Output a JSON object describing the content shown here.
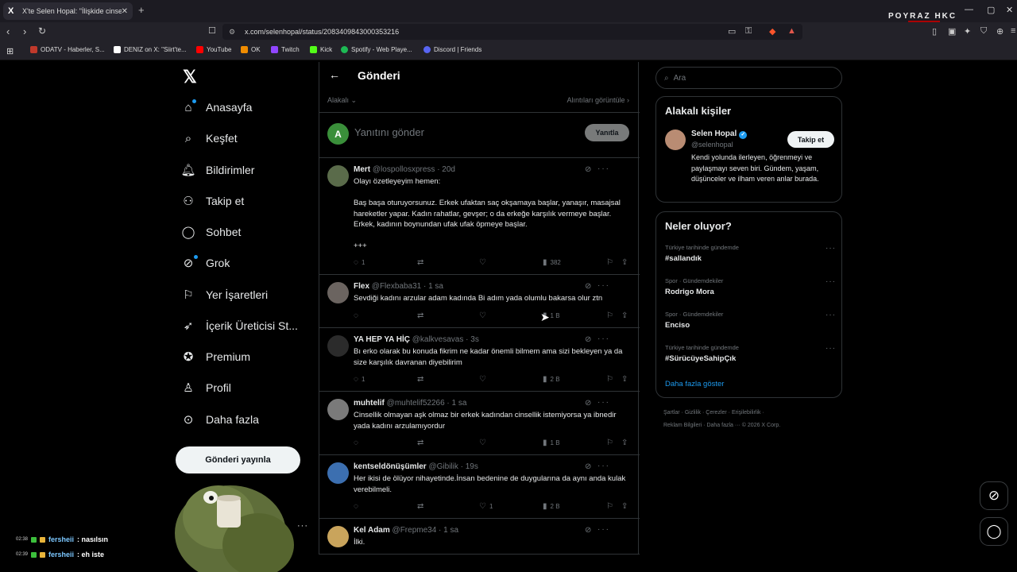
{
  "browser": {
    "tab_title": "X'te Selen Hopal: \"İlişkide cinsell",
    "tab_favicon": "X",
    "url": "x.com/selenhopal/status/2083409843000353216",
    "overlay_brand": "POYRAZ HKC",
    "bookmarks": [
      {
        "label": "ODATV - Haberler, S...",
        "color": "#c0392b"
      },
      {
        "label": "DENIZ on X: \"Siirt'te...",
        "color": "#ffffff"
      },
      {
        "label": "YouTube",
        "color": "#ff0000"
      },
      {
        "label": "OK",
        "color": "#f08c00"
      },
      {
        "label": "Twitch",
        "color": "#9146ff"
      },
      {
        "label": "Kick",
        "color": "#53fc18"
      },
      {
        "label": "Spotify - Web Playe...",
        "color": "#1db954"
      },
      {
        "label": "Discord | Friends",
        "color": "#5865f2"
      }
    ]
  },
  "nav": {
    "items": [
      {
        "label": "Anasayfa",
        "icon": "home-icon"
      },
      {
        "label": "Keşfet",
        "icon": "search-icon"
      },
      {
        "label": "Bildirimler",
        "icon": "bell-icon"
      },
      {
        "label": "Takip et",
        "icon": "add-user-icon"
      },
      {
        "label": "Sohbet",
        "icon": "chat-icon"
      },
      {
        "label": "Grok",
        "icon": "grok-icon"
      },
      {
        "label": "Yer İşaretleri",
        "icon": "bookmark-icon"
      },
      {
        "label": "İçerik Üreticisi St...",
        "icon": "rocket-icon"
      },
      {
        "label": "Premium",
        "icon": "premium-icon"
      },
      {
        "label": "Profil",
        "icon": "profile-icon"
      },
      {
        "label": "Daha fazla",
        "icon": "more-icon"
      }
    ],
    "post_button": "Gönderi yayınla"
  },
  "main": {
    "title": "Gönderi",
    "sort_label": "Alakalı",
    "quotes_link": "Alıntıları görüntüle",
    "compose_avatar": "A",
    "compose_placeholder": "Yanıtını gönder",
    "reply_button": "Yanıtla",
    "tweets": [
      {
        "name": "Mert",
        "handle": "@lospollosxpress · 20d",
        "text": "Olayı özetleyeyim hemen:\n\nBaş başa oturuyorsunuz. Erkek ufaktan saç okşamaya başlar, yanaşır, masajsal hareketler yapar. Kadın rahatlar, gevşer; o da erkeğe karşılık vermeye başlar. Erkek, kadının boynundan ufak ufak öpmeye başlar.\n\n+++",
        "replies": "1",
        "retweets": "",
        "likes": "",
        "views": "382",
        "avatar_color": "#5a6b4a"
      },
      {
        "name": "Flex",
        "handle": "@Flexbaba31 · 1 sa",
        "text": "Sevdiği kadını arzular adam kadında Bi adım yada olumlu bakarsa olur ztn",
        "replies": "",
        "retweets": "",
        "likes": "",
        "views": "1 B",
        "avatar_color": "#6b6460"
      },
      {
        "name": "YA HEP YA HİÇ",
        "handle": "@kalkvesavas · 3s",
        "text": "Bı erko olarak bu konuda fikrim ne kadar önemli bilmem ama sizi bekleyen ya da size karşılık davranan diyebilirim",
        "replies": "1",
        "retweets": "",
        "likes": "",
        "views": "2 B",
        "avatar_color": "#2b2b2b"
      },
      {
        "name": "muhtelif",
        "handle": "@muhtelif52266 · 1 sa",
        "text": "Cinsellik olmayan aşk olmaz bir erkek kadından cinsellik istemiyorsa ya ibnedir  yada kadını arzulamıyordur",
        "replies": "",
        "retweets": "",
        "likes": "",
        "views": "1 B",
        "avatar_color": "#7a7a7a"
      },
      {
        "name": "kentseldönüşümler",
        "handle": "@Gibilik · 19s",
        "text": "Her ikisi de ölüyor nihayetinde.İnsan bedenine de duygularına da aynı anda kulak verebilmeli.",
        "replies": "",
        "retweets": "",
        "likes": "1",
        "views": "2 B",
        "avatar_color": "#3c6fb0"
      },
      {
        "name": "Kel Adam",
        "handle": "@Frepme34 · 1 sa",
        "text": "İlki.",
        "replies": "",
        "retweets": "",
        "likes": "",
        "views": "",
        "avatar_color": "#c9a45c"
      }
    ]
  },
  "right": {
    "search_placeholder": "Ara",
    "people_title": "Alakalı kişiler",
    "person_name": "Selen Hopal",
    "person_handle": "@selenhopal",
    "follow_button": "Takip et",
    "person_bio": "Kendi yolunda ilerleyen, öğrenmeyi ve paylaşmayı seven biri. Gündem, yaşam, düşünceler ve ilham veren anlar burada.",
    "trends_title": "Neler oluyor?",
    "trends": [
      {
        "category": "Türkiye tarihinde gündemde",
        "name": "#sallandık"
      },
      {
        "category": "Spor · Gündemdekiler",
        "name": "Rodrigo Mora"
      },
      {
        "category": "Spor · Gündemdekiler",
        "name": "Enciso"
      },
      {
        "category": "Türkiye tarihinde gündemde",
        "name": "#SürücüyeSahipÇık"
      }
    ],
    "show_more": "Daha fazla göster",
    "footer_line1": "Şartlar  ·  Gizlilik  ·  Çerezler  ·  Erişilebilirlik  ·",
    "footer_line2": "Reklam Bilgileri  ·  Daha fazla ···  © 2026 X Corp."
  },
  "chat": [
    {
      "time": "02:38",
      "user": "fersheii",
      "message": ": nasılsın"
    },
    {
      "time": "02:39",
      "user": "fersheii",
      "message": ": eh iste"
    }
  ]
}
